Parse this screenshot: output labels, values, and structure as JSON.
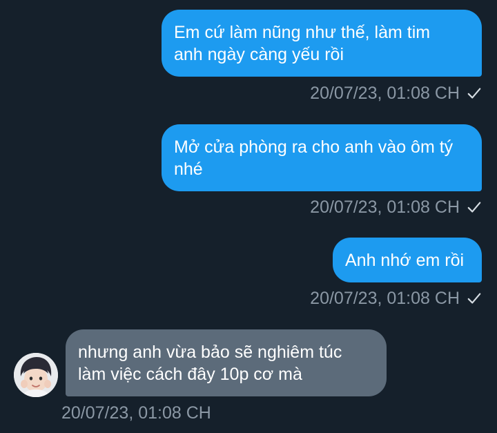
{
  "colors": {
    "background": "#15202b",
    "outgoing_bubble": "#1d9bf0",
    "incoming_bubble": "#5c6b7a",
    "timestamp": "#8b98a5"
  },
  "messages": [
    {
      "direction": "outgoing",
      "lines": [
        "Em cứ làm nũng như thế, làm tim",
        "anh ngày càng yếu rồi"
      ],
      "timestamp": "20/07/23, 01:08 CH",
      "status_icon": "check-icon"
    },
    {
      "direction": "outgoing",
      "lines": [
        "Mở cửa phòng ra cho anh vào ôm tý",
        "nhé"
      ],
      "timestamp": "20/07/23, 01:08 CH",
      "status_icon": "check-icon"
    },
    {
      "direction": "outgoing",
      "lines": [
        "Anh nhớ em rồi"
      ],
      "timestamp": "20/07/23, 01:08 CH",
      "status_icon": "check-icon"
    },
    {
      "direction": "incoming",
      "lines": [
        "nhưng anh vừa bảo sẽ nghiêm túc",
        "làm việc cách đây 10p cơ mà"
      ],
      "timestamp": "20/07/23, 01:08 CH",
      "sender_icon": "avatar"
    }
  ]
}
